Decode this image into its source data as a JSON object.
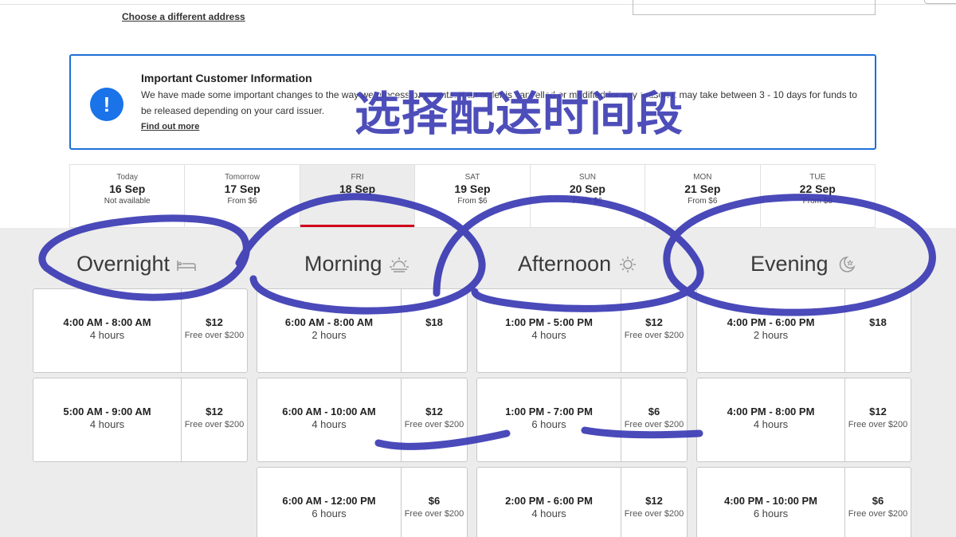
{
  "header": {
    "change_address_link": "Choose a different address"
  },
  "info": {
    "title": "Important Customer Information",
    "body": "We have made some important changes to the way we process payments. If an order is cancelled or modified for any reason it may take between 3 - 10 days for funds to be released depending on your card issuer.",
    "link": "Find out more",
    "icon_glyph": "!",
    "icon": "alert-circle-icon",
    "accent_color": "#1a73e8"
  },
  "annotation": {
    "text": "选择配送时间段",
    "color": "#3f3fb5"
  },
  "days": [
    {
      "name": "Today",
      "date": "16 Sep",
      "sub": "Not available"
    },
    {
      "name": "Tomorrow",
      "date": "17 Sep",
      "sub": "From $6"
    },
    {
      "name": "FRI",
      "date": "18 Sep",
      "sub": "",
      "selected": true
    },
    {
      "name": "SAT",
      "date": "19 Sep",
      "sub": "From $6"
    },
    {
      "name": "SUN",
      "date": "20 Sep",
      "sub": "From $6"
    },
    {
      "name": "MON",
      "date": "21 Sep",
      "sub": "From $6"
    },
    {
      "name": "TUE",
      "date": "22 Sep",
      "sub": "From $6"
    }
  ],
  "selected_color": "#d0021b",
  "columns": [
    {
      "title": "Overnight",
      "icon": "bed-icon",
      "slots": [
        {
          "time": "4:00 AM - 8:00 AM",
          "duration": "4 hours",
          "price": "$12",
          "note": "Free over $200"
        },
        {
          "time": "5:00 AM - 9:00 AM",
          "duration": "4 hours",
          "price": "$12",
          "note": "Free over $200"
        }
      ]
    },
    {
      "title": "Morning",
      "icon": "sunrise-icon",
      "slots": [
        {
          "time": "6:00 AM - 8:00 AM",
          "duration": "2 hours",
          "price": "$18",
          "note": ""
        },
        {
          "time": "6:00 AM - 10:00 AM",
          "duration": "4 hours",
          "price": "$12",
          "note": "Free over $200"
        },
        {
          "time": "6:00 AM - 12:00 PM",
          "duration": "6 hours",
          "price": "$6",
          "note": "Free over $200"
        }
      ]
    },
    {
      "title": "Afternoon",
      "icon": "sun-icon",
      "slots": [
        {
          "time": "1:00 PM - 5:00 PM",
          "duration": "4 hours",
          "price": "$12",
          "note": "Free over $200"
        },
        {
          "time": "1:00 PM - 7:00 PM",
          "duration": "6 hours",
          "price": "$6",
          "note": "Free over $200"
        },
        {
          "time": "2:00 PM - 6:00 PM",
          "duration": "4 hours",
          "price": "$12",
          "note": "Free over $200"
        }
      ]
    },
    {
      "title": "Evening",
      "icon": "moon-icon",
      "slots": [
        {
          "time": "4:00 PM - 6:00 PM",
          "duration": "2 hours",
          "price": "$18",
          "note": ""
        },
        {
          "time": "4:00 PM - 8:00 PM",
          "duration": "4 hours",
          "price": "$12",
          "note": "Free over $200"
        },
        {
          "time": "4:00 PM - 10:00 PM",
          "duration": "6 hours",
          "price": "$6",
          "note": "Free over $200"
        }
      ]
    }
  ]
}
